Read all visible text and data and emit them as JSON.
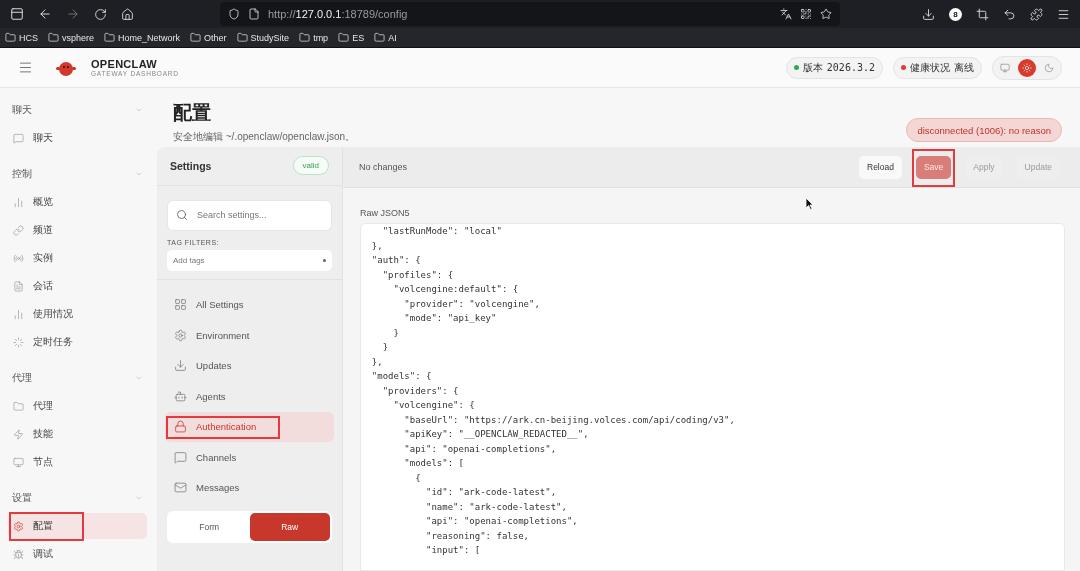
{
  "browser": {
    "url_prefix": "http://",
    "url_host": "127.0.0.1",
    "url_rest": ":18789/config",
    "extension_badge": "8",
    "bookmarks": [
      "HCS",
      "vsphere",
      "Home_Network",
      "Other",
      "StudySite",
      "tmp",
      "ES",
      "AI"
    ]
  },
  "header": {
    "brand": "OPENCLAW",
    "tagline": "GATEWAY DASHBOARD",
    "pills": [
      {
        "label": "版本",
        "value": "2026.3.2",
        "color": "#2fa84f"
      },
      {
        "label": "健康状况",
        "value": "离线",
        "color": "#e0393e"
      }
    ],
    "theme_options": [
      {
        "selected": false
      },
      {
        "selected": true
      },
      {
        "selected": false
      }
    ]
  },
  "sidebar": {
    "groups": [
      {
        "title": "聊天",
        "items": [
          {
            "label": "聊天",
            "selected": false,
            "annotated": false
          }
        ]
      },
      {
        "title": "控制",
        "items": [
          {
            "label": "概览",
            "selected": false,
            "annotated": false
          },
          {
            "label": "频道",
            "selected": false,
            "annotated": false
          },
          {
            "label": "实例",
            "selected": false,
            "annotated": false
          },
          {
            "label": "会话",
            "selected": false,
            "annotated": false
          },
          {
            "label": "使用情况",
            "selected": false,
            "annotated": false
          },
          {
            "label": "定时任务",
            "selected": false,
            "annotated": false
          }
        ]
      },
      {
        "title": "代理",
        "items": [
          {
            "label": "代理",
            "selected": false,
            "annotated": false
          },
          {
            "label": "技能",
            "selected": false,
            "annotated": false
          },
          {
            "label": "节点",
            "selected": false,
            "annotated": false
          }
        ]
      },
      {
        "title": "设置",
        "items": [
          {
            "label": "配置",
            "selected": true,
            "annotated": true
          },
          {
            "label": "调试",
            "selected": false,
            "annotated": false
          }
        ]
      }
    ]
  },
  "page": {
    "title": "配置",
    "subtitle": "安全地编辑 ~/.openclaw/openclaw.json。",
    "error": "disconnected (1006): no reason"
  },
  "settings": {
    "title": "Settings",
    "status": "valid",
    "search_placeholder": "Search settings...",
    "tag_filters_label": "TAG FILTERS:",
    "tags_placeholder": "Add tags",
    "nav": [
      {
        "label": "All Settings",
        "selected": false,
        "annotated": false
      },
      {
        "label": "Environment",
        "selected": false,
        "annotated": false
      },
      {
        "label": "Updates",
        "selected": false,
        "annotated": false
      },
      {
        "label": "Agents",
        "selected": false,
        "annotated": false
      },
      {
        "label": "Authentication",
        "selected": true,
        "annotated": true
      },
      {
        "label": "Channels",
        "selected": false,
        "annotated": false
      },
      {
        "label": "Messages",
        "selected": false,
        "annotated": false
      }
    ],
    "modes": [
      {
        "label": "Form",
        "selected": false
      },
      {
        "label": "Raw",
        "selected": true
      }
    ]
  },
  "editor": {
    "status": "No changes",
    "buttons": [
      {
        "label": "Reload",
        "kind": "plain",
        "disabled": false,
        "annotated": false
      },
      {
        "label": "Save",
        "kind": "primary",
        "disabled": true,
        "annotated": true
      },
      {
        "label": "Apply",
        "kind": "plain",
        "disabled": true,
        "annotated": false
      },
      {
        "label": "Update",
        "kind": "plain",
        "disabled": true,
        "annotated": false
      }
    ],
    "label": "Raw JSON5",
    "lines": [
      "    \"lastRunMode\": \"local\"",
      "  },",
      "  \"auth\": {",
      "    \"profiles\": {",
      "      \"volcengine:default\": {",
      "        \"provider\": \"volcengine\",",
      "        \"mode\": \"api_key\"",
      "      }",
      "    }",
      "  },",
      "  \"models\": {",
      "    \"providers\": {",
      "      \"volcengine\": {",
      "        \"baseUrl\": \"https://ark.cn-beijing.volces.com/api/coding/v3\",",
      "        \"apiKey\": \"__OPENCLAW_REDACTED__\",",
      "        \"api\": \"openai-completions\",",
      "        \"models\": [",
      "          {",
      "            \"id\": \"ark-code-latest\",",
      "            \"name\": \"ark-code-latest\",",
      "            \"api\": \"openai-completions\",",
      "            \"reasoning\": false,",
      "            \"input\": ["
    ]
  }
}
